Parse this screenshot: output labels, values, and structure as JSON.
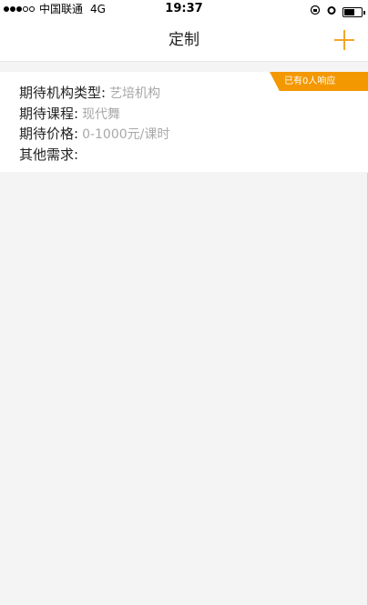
{
  "status_bar": {
    "carrier": "中国联通",
    "network": "4G",
    "time": "19:37",
    "signal_bars_filled": 3,
    "signal_bars_total": 5
  },
  "nav": {
    "title": "定制",
    "add_icon": "plus-icon",
    "accent_color": "#f5a623"
  },
  "request": {
    "badge": "已有0人响应",
    "rows": [
      {
        "label": "期待机构类型:",
        "value": "艺培机构"
      },
      {
        "label": "期待课程:",
        "value": "现代舞"
      },
      {
        "label": "期待价格:",
        "value": "0-1000元/课时"
      },
      {
        "label": "其他需求:",
        "value": ""
      }
    ]
  }
}
